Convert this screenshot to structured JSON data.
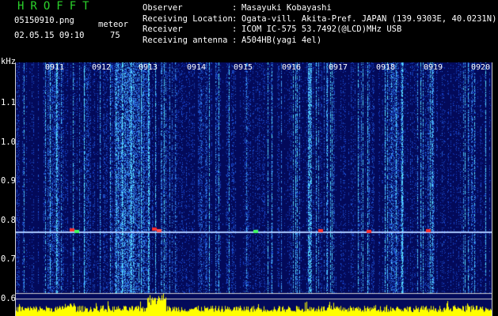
{
  "header": {
    "app_title": "HROFFT",
    "filename": "05150910.png",
    "mode": "meteor",
    "datetime": "02.05.15 09:10",
    "count": "75"
  },
  "info": [
    {
      "label": "Observer",
      "value": "Masayuki Kobayashi"
    },
    {
      "label": "Receiving Location",
      "value": "Ogata-vill. Akita-Pref. JAPAN (139.9303E, 40.0231N)"
    },
    {
      "label": "Receiver",
      "value": "ICOM IC-575 53.7492(@LCD)MHz USB"
    },
    {
      "label": "Receiving antenna",
      "value": "A504HB(yagi 4el)"
    }
  ],
  "y_axis": {
    "unit": "kHz",
    "ticks": [
      "1.1",
      "1.0",
      "0.9",
      "0.8",
      "0.7",
      "0.6"
    ]
  },
  "time_ticks": [
    "0911",
    "0912",
    "0913",
    "0914",
    "0915",
    "0916",
    "0917",
    "0918",
    "0919",
    "0920"
  ],
  "colors": {
    "background": "#000000",
    "title": "#2bd32b",
    "spectrogram_bg": "#030a5a",
    "noise": "#2e5cff",
    "carrier_line": "#aac8ff",
    "amplitude": "#ffff00"
  }
}
